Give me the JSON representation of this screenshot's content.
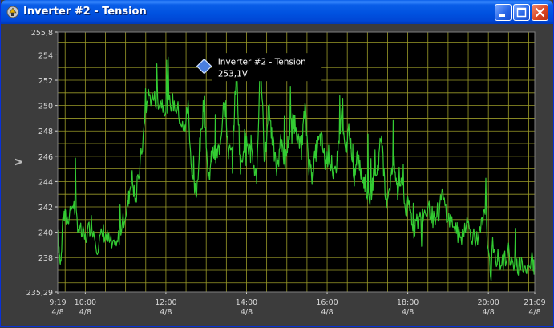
{
  "window": {
    "title": "Inverter #2 - Tension",
    "icon": "inverter-app-icon",
    "controls": {
      "minimize_icon": "minimize-icon",
      "maximize_icon": "maximize-icon",
      "close_icon": "close-icon"
    }
  },
  "colors": {
    "plot_background": "#000000",
    "grid": "#9a9a28",
    "series": "#33cc33",
    "frame": "#3c3c3c",
    "axis_text": "#d8d8d8",
    "marker": "#4a7fe0"
  },
  "chart_data": {
    "type": "line",
    "ylabel": "V",
    "ylim": [
      235.29,
      255.8
    ],
    "y_ticks": [
      "255,8",
      "254",
      "252",
      "250",
      "248",
      "246",
      "244",
      "242",
      "240",
      "238",
      "235,29"
    ],
    "y_tick_values": [
      255.8,
      254,
      252,
      250,
      248,
      246,
      244,
      242,
      240,
      238,
      235.29
    ],
    "x_ticks": [
      {
        "time": "9:19",
        "date": "4/8",
        "hour": 9.3167
      },
      {
        "time": "10:00",
        "date": "4/8",
        "hour": 10.0
      },
      {
        "time": "12:00",
        "date": "4/8",
        "hour": 12.0
      },
      {
        "time": "14:00",
        "date": "4/8",
        "hour": 14.0
      },
      {
        "time": "16:00",
        "date": "4/8",
        "hour": 16.0
      },
      {
        "time": "18:00",
        "date": "4/8",
        "hour": 18.0
      },
      {
        "time": "20:00",
        "date": "4/8",
        "hour": 20.0
      },
      {
        "time": "21:09",
        "date": "4/8",
        "hour": 21.15
      }
    ],
    "xlim": [
      9.3167,
      21.15
    ],
    "grid": true,
    "series": [
      {
        "x": [
          9.32,
          9.38,
          9.45,
          9.55,
          9.7,
          9.85,
          10.0,
          10.15,
          10.3,
          10.45,
          10.6,
          10.75,
          10.9,
          11.05,
          11.15,
          11.25,
          11.4,
          11.55,
          11.7,
          11.85,
          12.0,
          12.15,
          12.3,
          12.45,
          12.55,
          12.65,
          12.75,
          12.85,
          12.95,
          13.05,
          13.15,
          13.25,
          13.35,
          13.45,
          13.55,
          13.65,
          13.75,
          13.85,
          13.95,
          14.05,
          14.15,
          14.25,
          14.35,
          14.45,
          14.55,
          14.65,
          14.75,
          14.85,
          14.95,
          15.05,
          15.15,
          15.25,
          15.35,
          15.45,
          15.55,
          15.65,
          15.75,
          15.85,
          15.95,
          16.05,
          16.15,
          16.25,
          16.35,
          16.45,
          16.55,
          16.65,
          16.75,
          16.85,
          16.95,
          17.05,
          17.15,
          17.25,
          17.35,
          17.45,
          17.55,
          17.65,
          17.75,
          17.85,
          17.95,
          18.05,
          18.15,
          18.25,
          18.4,
          18.55,
          18.7,
          18.85,
          19.0,
          19.15,
          19.3,
          19.45,
          19.6,
          19.75,
          19.9,
          20.05,
          20.2,
          20.35,
          20.5,
          20.65,
          20.8,
          20.95,
          21.1,
          21.15
        ],
        "y": [
          240.2,
          237.2,
          241.3,
          241.0,
          242.3,
          240.2,
          239.4,
          240.8,
          238.9,
          240.0,
          239.2,
          238.4,
          240.6,
          242.0,
          244.5,
          242.3,
          246.4,
          250.8,
          250.5,
          250.4,
          249.8,
          250.3,
          249.6,
          247.8,
          250.1,
          244.2,
          242.9,
          246.8,
          250.8,
          243.8,
          246.3,
          245.9,
          247.1,
          250.9,
          246.4,
          246.1,
          253.1,
          244.9,
          247.4,
          246.7,
          245.6,
          244.4,
          253.9,
          245.1,
          250.2,
          247.0,
          244.9,
          247.7,
          245.4,
          247.5,
          249.1,
          248.0,
          246.4,
          249.8,
          245.3,
          245.0,
          246.8,
          247.5,
          245.5,
          246.2,
          244.0,
          245.8,
          249.5,
          246.1,
          248.4,
          243.7,
          246.0,
          244.5,
          243.8,
          242.4,
          244.3,
          245.0,
          247.7,
          242.3,
          243.7,
          245.5,
          243.1,
          244.3,
          241.6,
          241.9,
          240.3,
          240.9,
          241.5,
          241.8,
          240.4,
          243.0,
          241.1,
          240.6,
          239.4,
          240.9,
          239.8,
          239.3,
          241.4,
          237.9,
          238.0,
          237.5,
          238.5,
          236.9,
          237.6,
          237.0,
          237.8,
          237.2
        ]
      }
    ],
    "tooltip": {
      "series": "Inverter #2 - Tension",
      "value": "253,1V",
      "x": 12.95,
      "y": 253.1
    }
  }
}
